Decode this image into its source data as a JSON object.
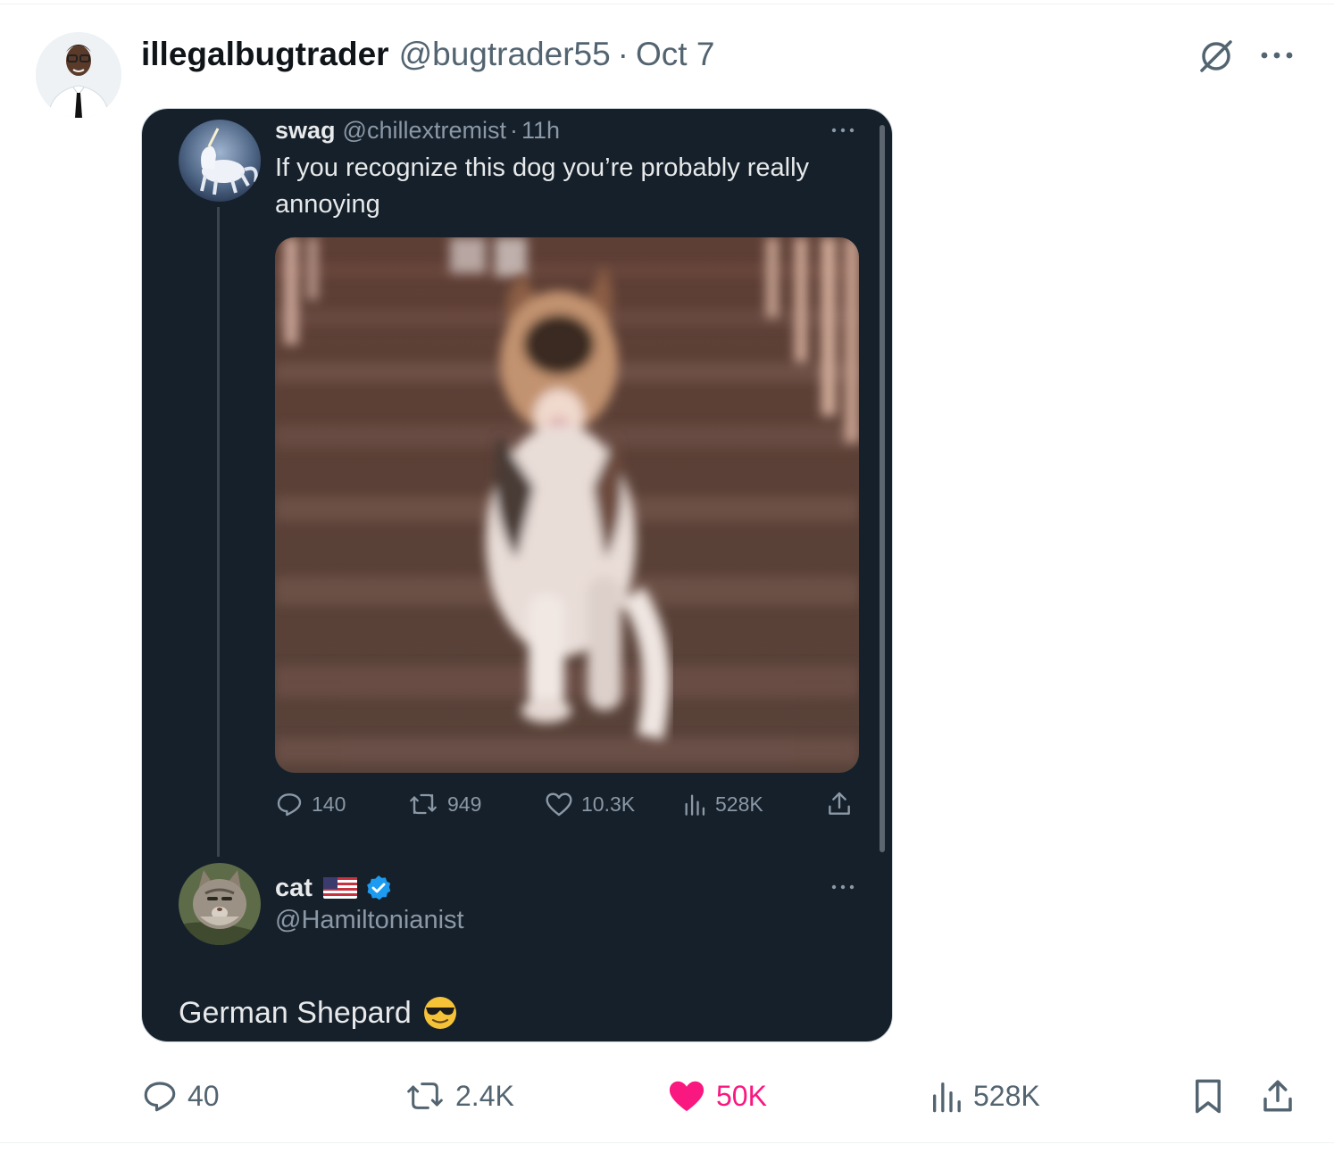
{
  "tweet": {
    "author_name": "illegalbugtrader",
    "author_handle": "@bugtrader55",
    "separator": "·",
    "date": "Oct 7"
  },
  "embedded": {
    "quoted": {
      "name": "swag",
      "handle": "@chillextremist",
      "separator": "·",
      "time": "11h",
      "text": "If you recognize this dog you’re probably really annoying",
      "stats": {
        "replies": "140",
        "reposts": "949",
        "likes": "10.3K",
        "views": "528K"
      }
    },
    "reply": {
      "name": "cat",
      "handle": "@Hamiltonianist",
      "text": "German Shepard"
    }
  },
  "actions": {
    "replies": "40",
    "reposts": "2.4K",
    "likes": "50K",
    "views": "528K"
  },
  "colors": {
    "card_bg": "#15202b",
    "like_pink": "#f91880",
    "verified_blue": "#1d9bf0",
    "muted": "#536471"
  },
  "icons": [
    "grok-icon",
    "more-icon",
    "reply-icon",
    "repost-icon",
    "like-icon",
    "views-icon",
    "share-icon",
    "bookmark-icon",
    "verified-badge-icon",
    "us-flag-icon",
    "sunglasses-emoji-icon"
  ]
}
